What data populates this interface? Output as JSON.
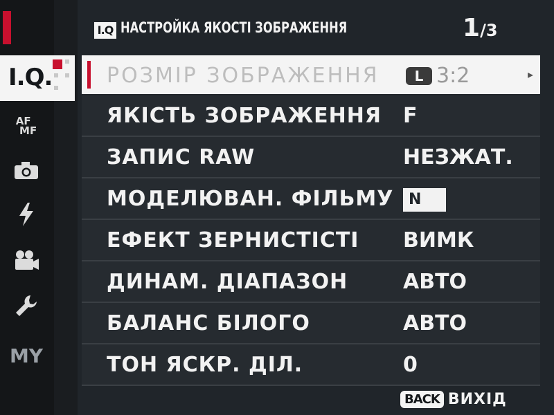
{
  "header": {
    "badge": "I.Q",
    "title": "НАСТРОЙКА ЯКОСТІ ЗОБРАЖЕННЯ",
    "page_current": "1",
    "page_total": "/3"
  },
  "tabs": [
    {
      "name": "image-quality",
      "label": "I.Q."
    },
    {
      "name": "af-mf",
      "label": "AF MF"
    },
    {
      "name": "shooting",
      "icon": "camera-icon"
    },
    {
      "name": "flash",
      "icon": "flash-icon"
    },
    {
      "name": "movie",
      "icon": "movie-camera-icon"
    },
    {
      "name": "setup",
      "icon": "wrench-icon"
    },
    {
      "name": "my-menu",
      "label": "MY"
    }
  ],
  "menu": {
    "items": [
      {
        "label": "РОЗМІР ЗОБРАЖЕННЯ",
        "badge": "L",
        "value": "3:2",
        "selected": true
      },
      {
        "label": "ЯКІСТЬ ЗОБРАЖЕННЯ",
        "value": "F"
      },
      {
        "label": "ЗАПИС RAW",
        "value": "НЕЗЖАТ."
      },
      {
        "label": "МОДЕЛЮВАН. ФІЛЬМУ",
        "value_icon": "film-simulation-icon",
        "value_icon_text": "N"
      },
      {
        "label": "ЕФЕКТ ЗЕРНИСТІСТІ",
        "value": "ВИМК"
      },
      {
        "label": "ДИНАМ. ДІАПАЗОН",
        "value": "АВТО"
      },
      {
        "label": "БАЛАНС БІЛОГО",
        "value": "АВТО"
      },
      {
        "label": "ТОН ЯСКР. ДІЛ.",
        "value": "0"
      }
    ]
  },
  "footer": {
    "back_label": "BACK",
    "exit_label": "ВИХІД"
  },
  "colors": {
    "accent": "#c8102e",
    "panel": "#20252a",
    "selected_row": "#f4f4f4"
  }
}
